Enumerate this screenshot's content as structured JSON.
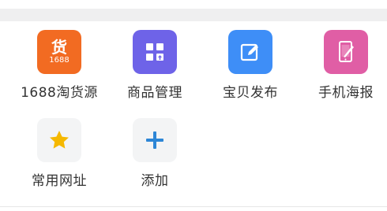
{
  "apps": [
    {
      "label": "1688淘货源",
      "icon": "1688-source-icon",
      "color": "#f26b22",
      "glyph": "货",
      "sub": "1688"
    },
    {
      "label": "商品管理",
      "icon": "product-manage-icon",
      "color": "#6e63e8"
    },
    {
      "label": "宝贝发布",
      "icon": "publish-icon",
      "color": "#3e8ef7"
    },
    {
      "label": "手机海报",
      "icon": "mobile-poster-icon",
      "color": "#e05ea5"
    },
    {
      "label": "常用网址",
      "icon": "star-icon",
      "color": "#f5f5f5"
    },
    {
      "label": "添加",
      "icon": "add-icon",
      "color": "#f5f5f5"
    }
  ]
}
